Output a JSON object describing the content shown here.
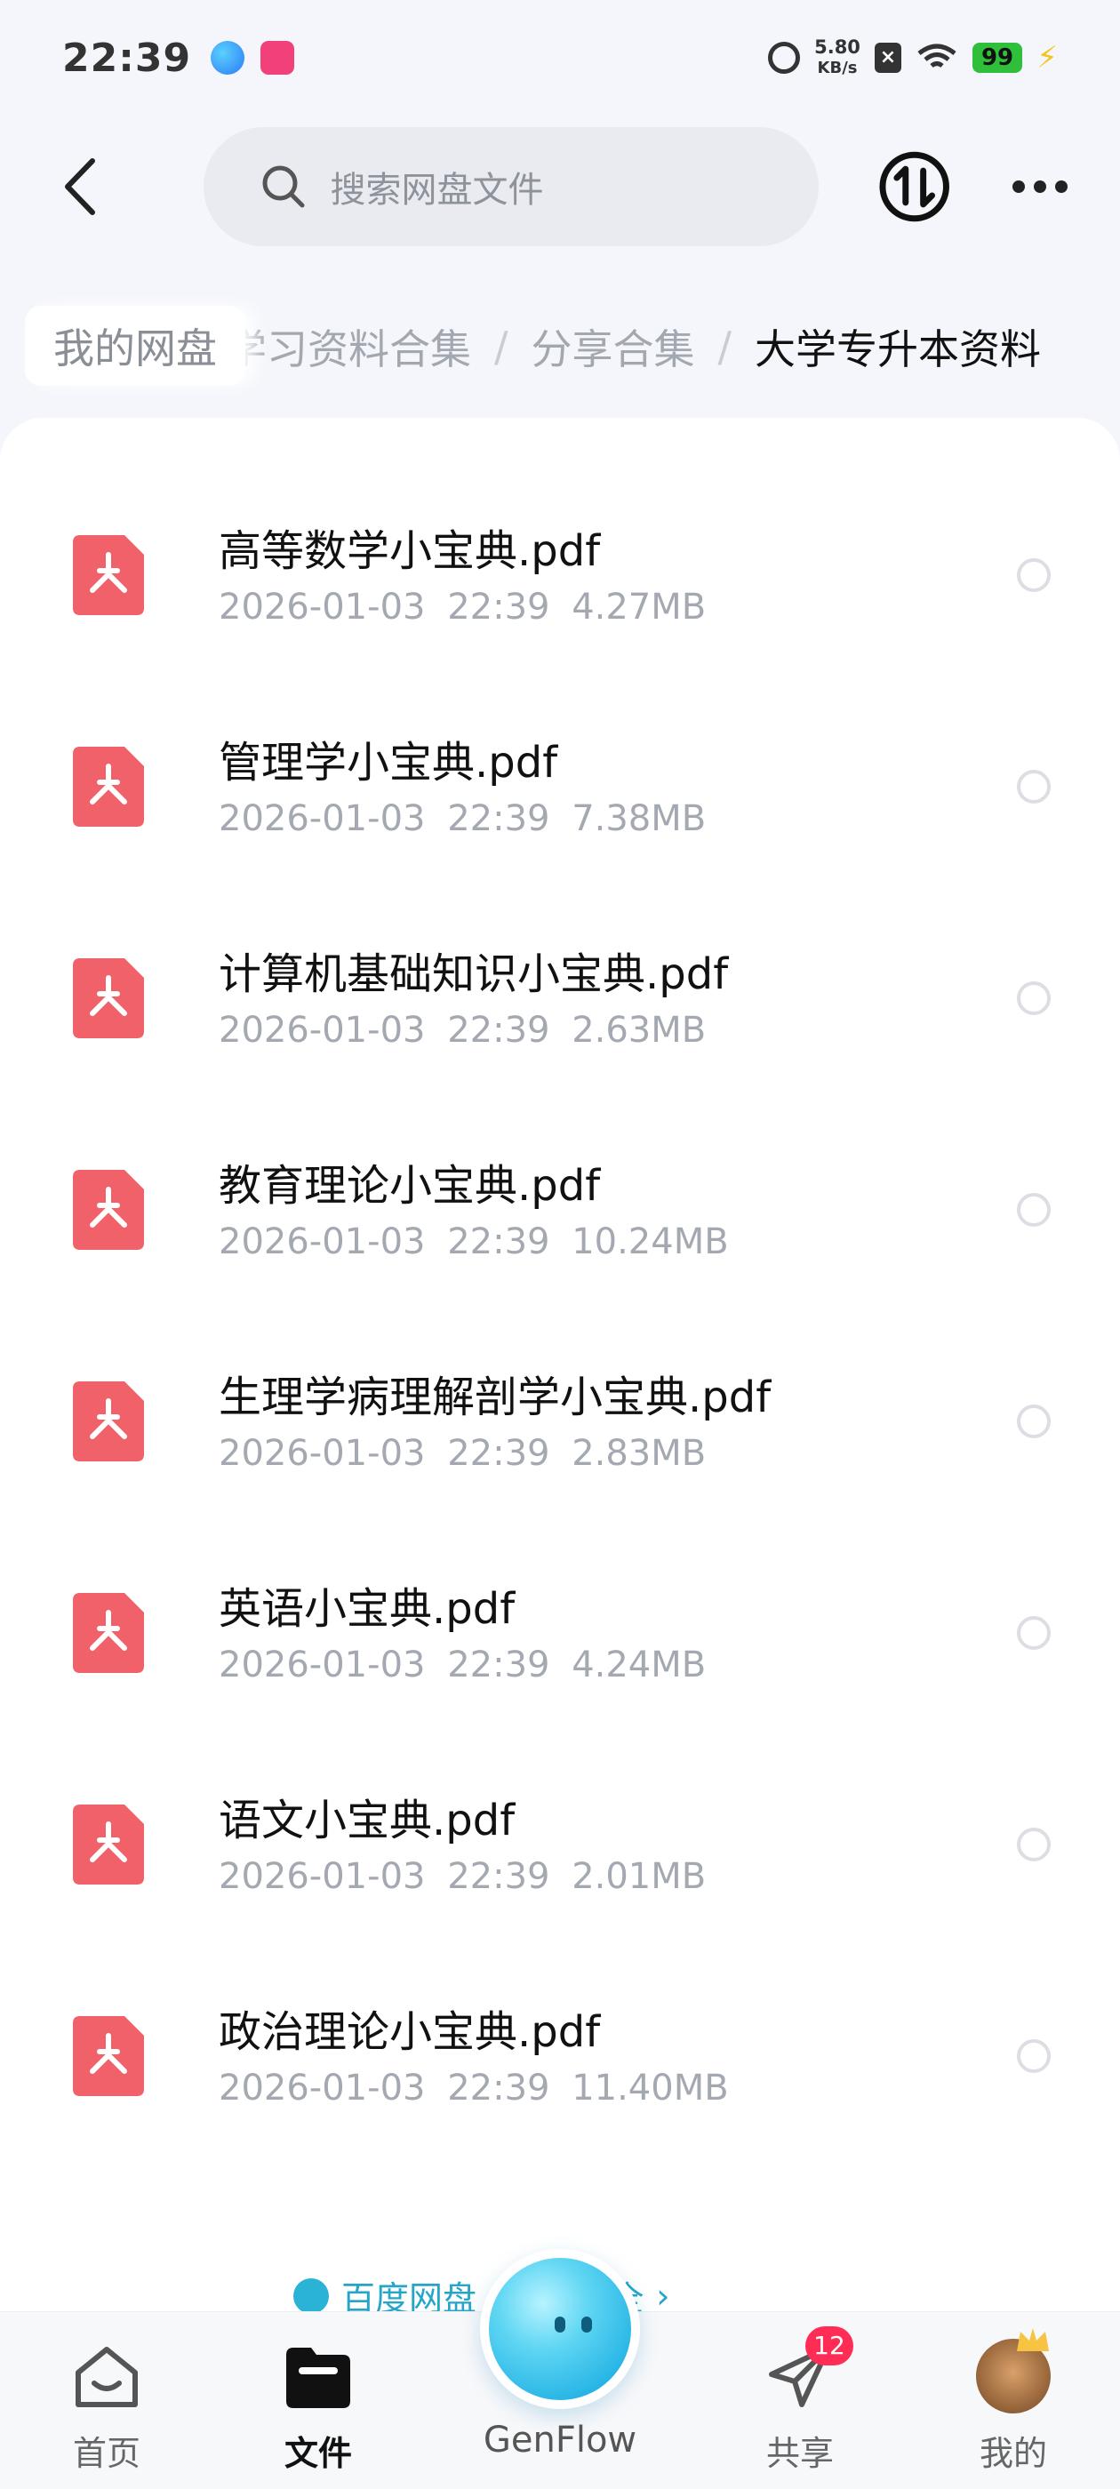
{
  "status_bar": {
    "time": "22:39",
    "net_speed_value": "5.80",
    "net_speed_unit": "KB/s",
    "battery": "99"
  },
  "header": {
    "search_placeholder": "搜索网盘文件"
  },
  "breadcrumb": {
    "root": "我的网盘",
    "items": [
      "学习资料合集",
      "分享合集"
    ],
    "separator": "/",
    "current": "大学专升本资料"
  },
  "files": [
    {
      "name": "高等数学小宝典.pdf",
      "date": "2026-01-03",
      "time": "22:39",
      "size": "4.27MB"
    },
    {
      "name": "管理学小宝典.pdf",
      "date": "2026-01-03",
      "time": "22:39",
      "size": "7.38MB"
    },
    {
      "name": "计算机基础知识小宝典.pdf",
      "date": "2026-01-03",
      "time": "22:39",
      "size": "2.63MB"
    },
    {
      "name": "教育理论小宝典.pdf",
      "date": "2026-01-03",
      "time": "22:39",
      "size": "10.24MB"
    },
    {
      "name": "生理学病理解剖学小宝典.pdf",
      "date": "2026-01-03",
      "time": "22:39",
      "size": "2.83MB"
    },
    {
      "name": "英语小宝典.pdf",
      "date": "2026-01-03",
      "time": "22:39",
      "size": "4.24MB"
    },
    {
      "name": "语文小宝典.pdf",
      "date": "2026-01-03",
      "time": "22:39",
      "size": "2.01MB"
    },
    {
      "name": "政治理论小宝典.pdf",
      "date": "2026-01-03",
      "time": "22:39",
      "size": "11.40MB"
    }
  ],
  "banner": {
    "text": "百度网盘 · 数据安全"
  },
  "bottom_nav": {
    "home": "首页",
    "files": "文件",
    "genflow": "GenFlow",
    "share": "共享",
    "share_badge": "12",
    "mine": "我的"
  },
  "colors": {
    "pdf_icon": "#f0616a",
    "accent": "#25a6c9",
    "badge": "#ff2d55"
  }
}
